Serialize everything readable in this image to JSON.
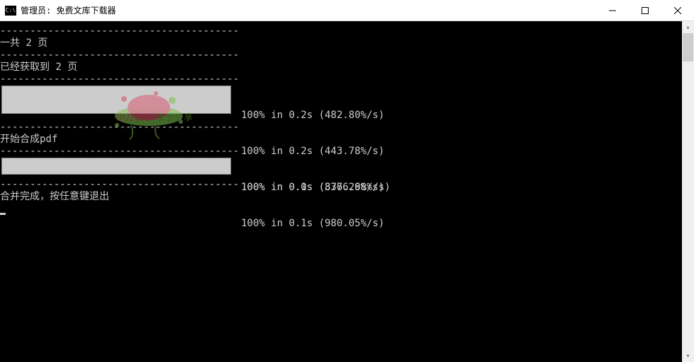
{
  "window": {
    "icon_text": "C:\\",
    "title": "管理员: 免费文库下载器"
  },
  "lines": {
    "total_pages": "一共 2 页",
    "fetched": "已经获取到 2 页",
    "start_pdf": "开始合成pdf",
    "done": "合并完成，按任意键退出"
  },
  "progress1": {
    "side_lines": [
      "100% in 0.2s (482.80%/s)",
      "100% in 0.2s (443.78%/s)",
      "100% in 0.0s (3776.68%/s)"
    ]
  },
  "progress2": {
    "side_lines": [
      "100% in 0.1s (836.29%/s)",
      "100% in 0.1s (980.05%/s)"
    ]
  },
  "watermark": {
    "left": "小刀娱乐",
    "right": "乐于分享"
  }
}
